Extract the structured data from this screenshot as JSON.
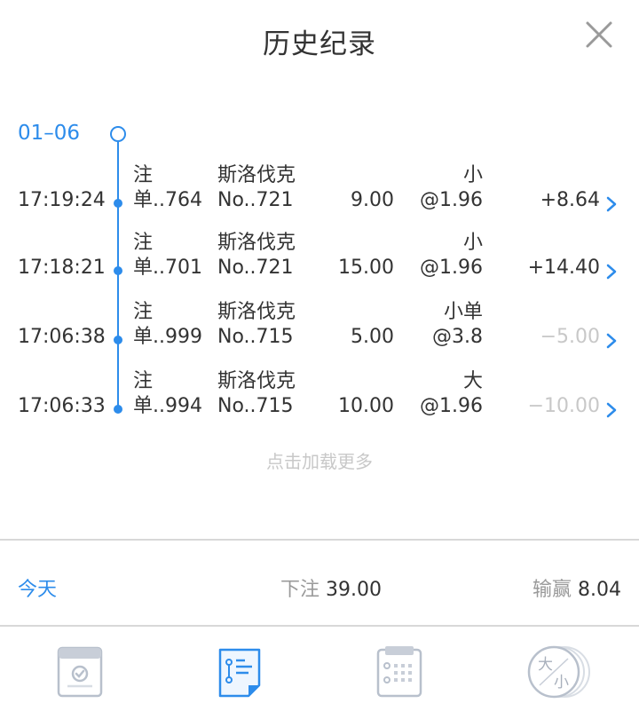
{
  "header": {
    "title": "历史纪录",
    "close_icon": "close-icon"
  },
  "timeline": {
    "date": "01–06",
    "accent": "#2d8ceb"
  },
  "records": [
    {
      "time": "17:19:24",
      "order_type": "注",
      "order_no": "单..764",
      "league": "斯洛伐克",
      "match": "No..721",
      "stake": "9.00",
      "bet_type": "小",
      "odds": "@1.96",
      "result": "+8.64"
    },
    {
      "time": "17:18:21",
      "order_type": "注",
      "order_no": "单..701",
      "league": "斯洛伐克",
      "match": "No..721",
      "stake": "15.00",
      "bet_type": "小",
      "odds": "@1.96",
      "result": "+14.40"
    },
    {
      "time": "17:06:38",
      "order_type": "注",
      "order_no": "单..999",
      "league": "斯洛伐克",
      "match": "No..715",
      "stake": "5.00",
      "bet_type": "小单",
      "odds": "@3.8",
      "result": "−5.00"
    },
    {
      "time": "17:06:33",
      "order_type": "注",
      "order_no": "单..994",
      "league": "斯洛伐克",
      "match": "No..715",
      "stake": "10.00",
      "bet_type": "大",
      "odds": "@1.96",
      "result": "−10.00"
    }
  ],
  "load_more": "点击加载更多",
  "summary": {
    "today": "今天",
    "bet_label": "下注",
    "bet_value": "39.00",
    "win_label": "输赢",
    "win_value": "8.04"
  },
  "tabs": [
    {
      "icon": "betting-slip-icon",
      "active": false,
      "dy": "大",
      "dx": "小"
    },
    {
      "icon": "history-list-icon",
      "active": true
    },
    {
      "icon": "calendar-grid-icon",
      "active": false
    },
    {
      "icon": "big-small-coin-icon",
      "active": false,
      "big": "大",
      "small": "小"
    }
  ],
  "colors": {
    "accent": "#2d8ceb",
    "muted": "#c8c8c8",
    "text": "#333333",
    "icon_inactive": "#b8c0cc"
  }
}
